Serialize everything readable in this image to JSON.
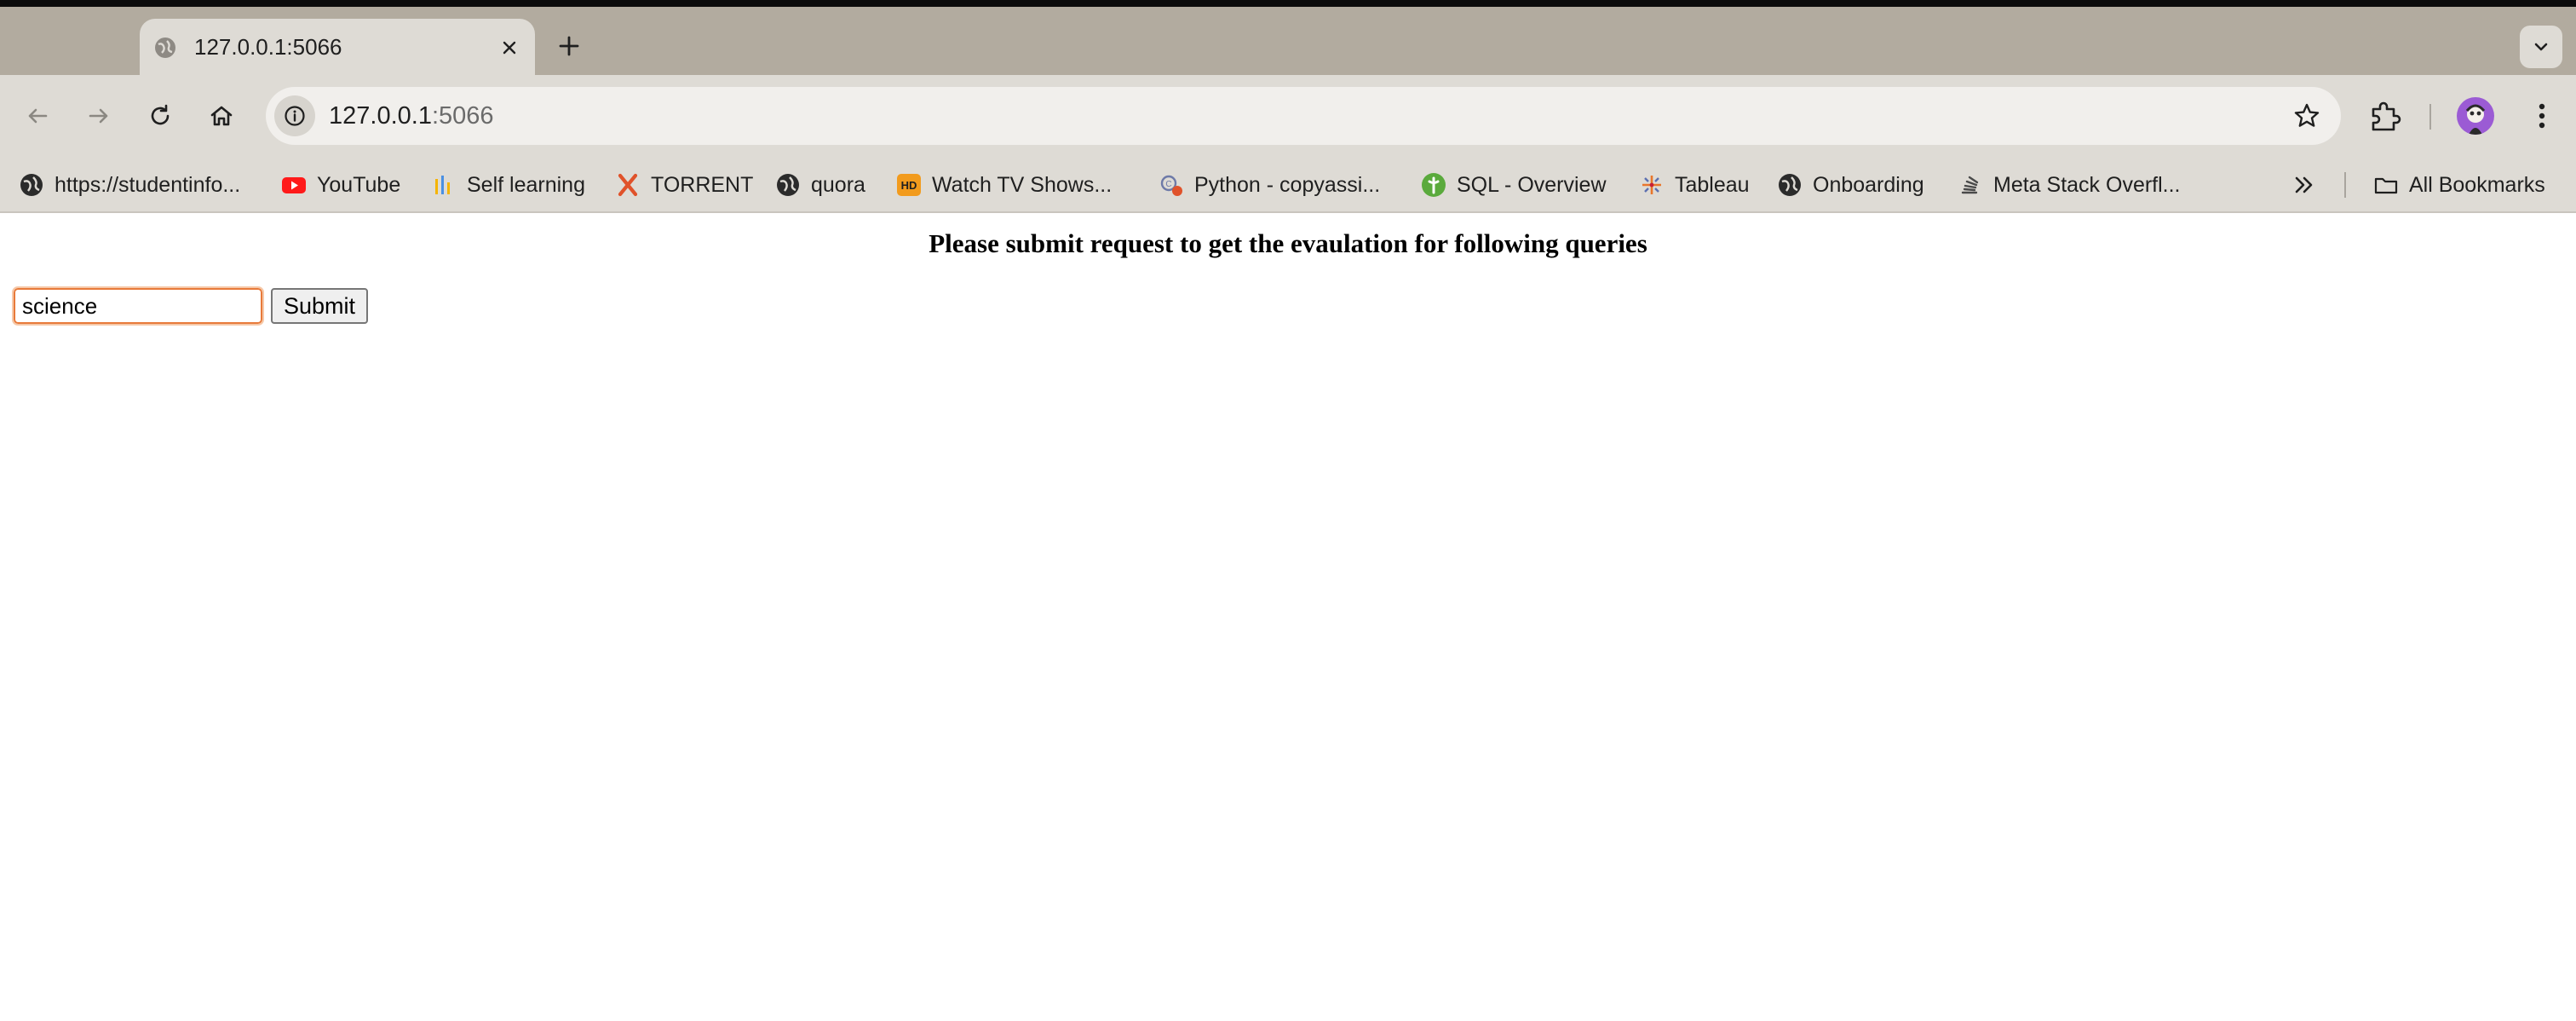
{
  "browser": {
    "tab": {
      "title": "127.0.0.1:5066"
    },
    "address": {
      "host": "127.0.0.1",
      "port": ":5066"
    },
    "bookmarks": [
      {
        "label": "https://studentinfo...",
        "icon": "globe-icon"
      },
      {
        "label": "YouTube",
        "icon": "youtube-icon"
      },
      {
        "label": "Self learning",
        "icon": "bars-icon"
      },
      {
        "label": "TORRENT",
        "icon": "x-logo-icon"
      },
      {
        "label": "quora",
        "icon": "globe-icon"
      },
      {
        "label": "Watch TV Shows...",
        "icon": "hd-icon"
      },
      {
        "label": "Python - copyassi...",
        "icon": "copyassignment-icon"
      },
      {
        "label": "SQL - Overview",
        "icon": "tutorialspoint-icon"
      },
      {
        "label": "Tableau",
        "icon": "tableau-icon"
      },
      {
        "label": "Onboarding",
        "icon": "globe-icon"
      },
      {
        "label": "Meta Stack Overfl...",
        "icon": "stack-exchange-icon"
      }
    ],
    "all_bookmarks_label": "All Bookmarks"
  },
  "page": {
    "title": "Please submit request to get the evaulation for following queries",
    "query_value": "science",
    "submit_label": "Submit"
  },
  "colors": {
    "tab_strip": "#b2ab9f",
    "toolbar": "#dedbd5",
    "input_focus": "#e87a3a",
    "avatar": "#9b5bd4"
  }
}
